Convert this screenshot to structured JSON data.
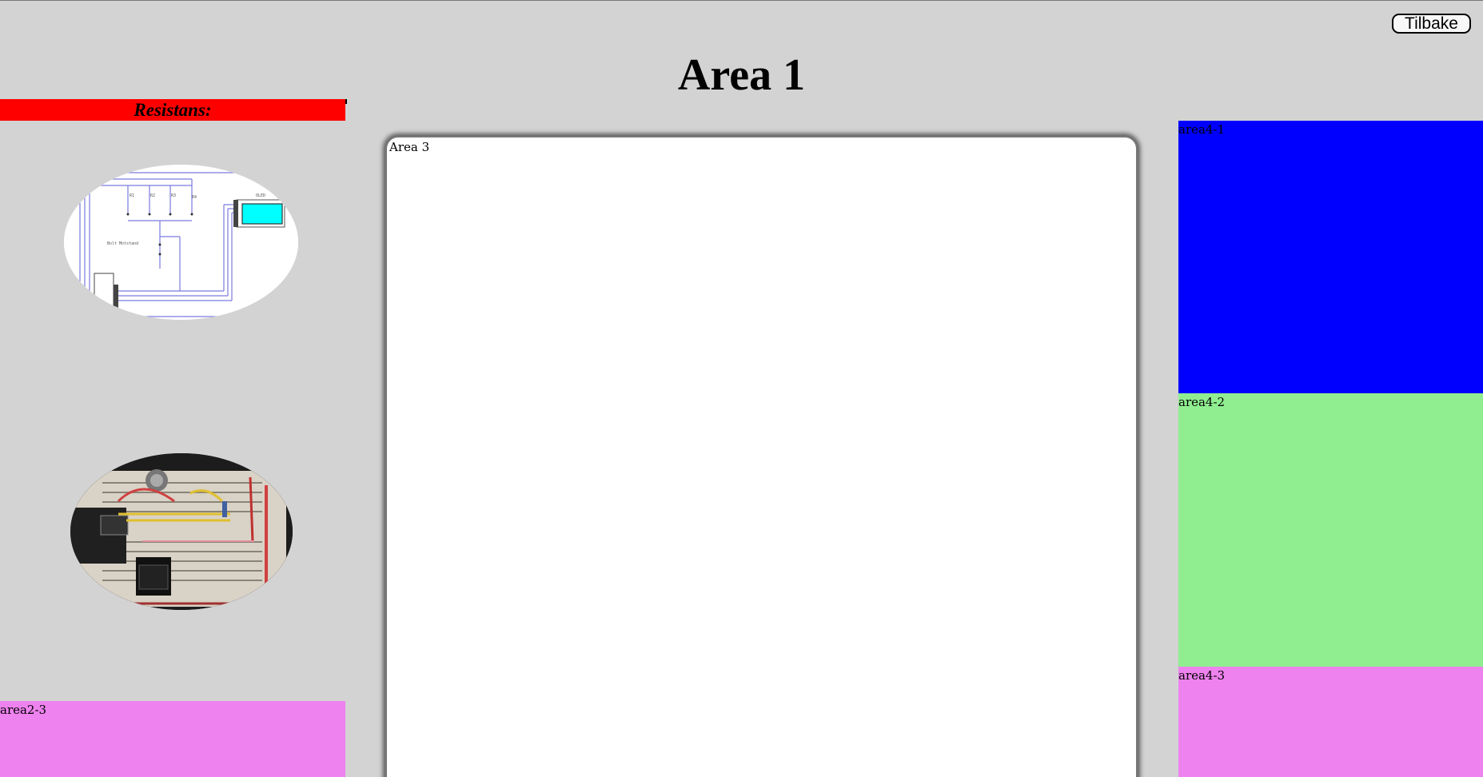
{
  "header": {
    "title": "Area 1",
    "back_button_label": "Tilbake"
  },
  "left_column": {
    "resist_label": "Resistans:",
    "images": [
      {
        "name": "schematic-image",
        "text": "Bolt Motstand",
        "label": "OLED"
      },
      {
        "name": "breadboard-photo"
      }
    ],
    "bottom_panel_label": "area2-3"
  },
  "main": {
    "area3_label": "Area 3"
  },
  "right_column": {
    "panels": [
      {
        "label": "area4-1",
        "color": "#0000ff"
      },
      {
        "label": "area4-2",
        "color": "#90ee90"
      },
      {
        "label": "area4-3",
        "color": "#ee82ee"
      }
    ]
  },
  "colors": {
    "background": "#d3d3d3",
    "resist_bar": "#ff0000",
    "area3_bg": "#ffffff"
  }
}
